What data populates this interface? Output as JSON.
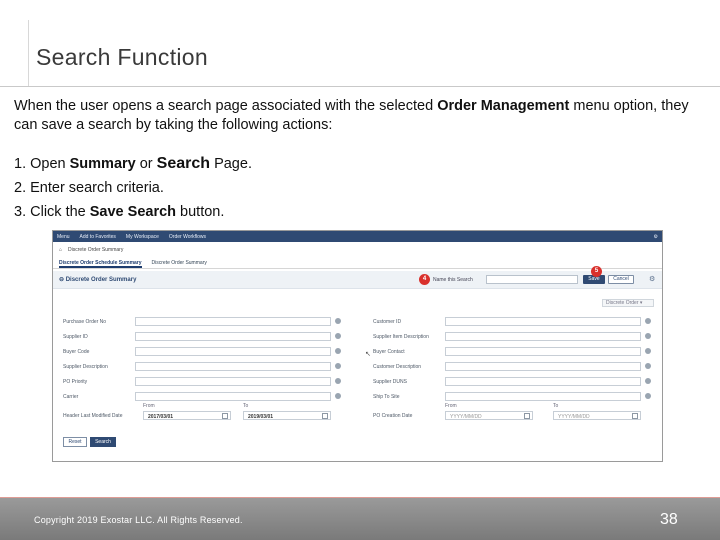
{
  "slide": {
    "title": "Search Function",
    "intro_text": "When the user opens a search page associated with the selected",
    "intro_bold": "Order Management",
    "intro_rest": "menu option, they can save a search by taking the following actions:",
    "steps": [
      {
        "pre": "1. Open ",
        "b1": "Summary",
        "mid": " or ",
        "b2": "Search",
        "post": " Page."
      },
      {
        "pre": "2. Enter search criteria."
      },
      {
        "pre": "3. Click the ",
        "b1": "Save Search",
        "post": " button."
      }
    ]
  },
  "app": {
    "nav": [
      "Menu",
      "Add to Favorites",
      "My Workspace",
      "Order Workflows"
    ],
    "breadcrumb": "Discrete Order Summary",
    "tabs": [
      "Discrete Order Schedule Summary",
      "Discrete Order Summary"
    ],
    "summary_title": "Discrete Order Summary",
    "name_label": "Name this Search",
    "save_label": "Save",
    "cancel_label": "Cancel",
    "badge_four": "4",
    "badge_five": "5",
    "dropdown_label": "Discrete Order",
    "left_fields": [
      "Purchase Order No",
      "Supplier ID",
      "Buyer Code",
      "Supplier Description",
      "PO Priority",
      "Carrier"
    ],
    "right_fields": [
      "Customer ID",
      "Supplier Item Description",
      "Buyer Contact",
      "Customer Description",
      "Supplier DUNS",
      "Ship To Site"
    ],
    "left_date_label": "Header Last Modified Date",
    "right_date_label": "PO Creation Date",
    "from_caption": "From",
    "to_caption": "To",
    "left_from": "2017/03/01",
    "left_to": "2019/03/01",
    "right_from": "YYYY/MM/DD",
    "right_to": "YYYY/MM/DD",
    "reset_label": "Reset",
    "search_label": "Search"
  },
  "footer": {
    "copyright": "Copyright 2019 Exostar LLC. All Rights Reserved.",
    "page": "38"
  },
  "colors": {
    "appbar": "#2f4a73",
    "badge": "#d9302c",
    "footer": "#8b8b8b"
  }
}
